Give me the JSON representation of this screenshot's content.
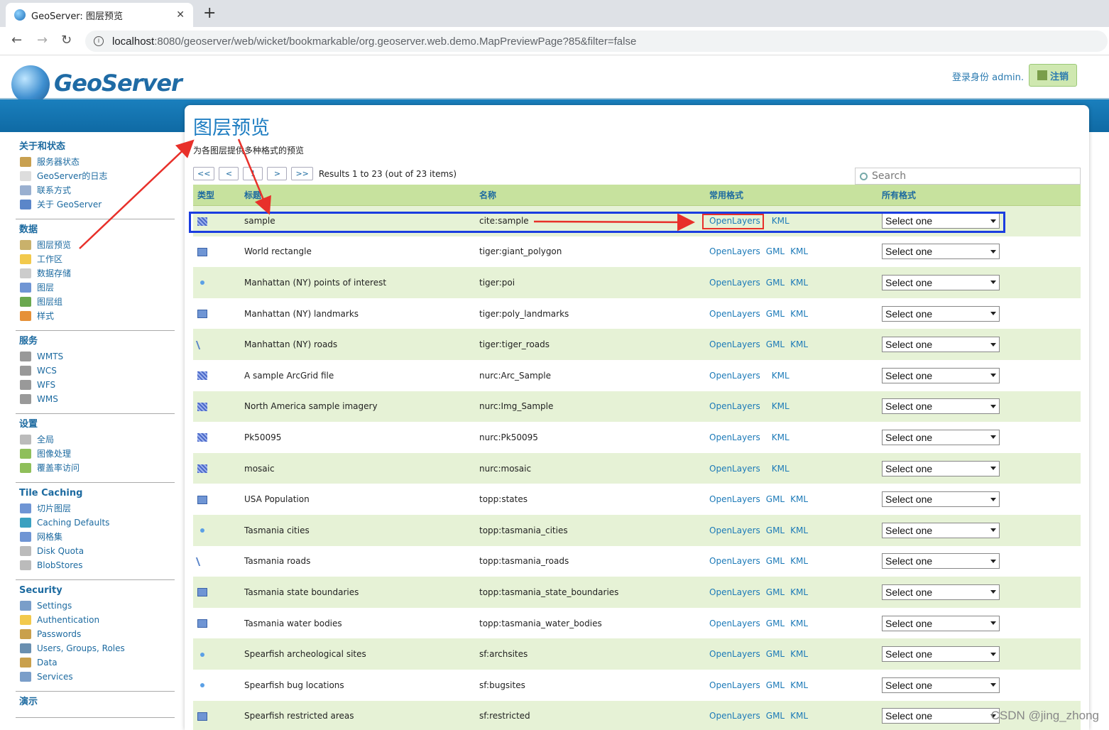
{
  "browser": {
    "tab_title": "GeoServer: 图层预览",
    "tab_close": "✕",
    "new_tab": "+",
    "url_host": "localhost",
    "url_path": ":8080/geoserver/web/wicket/bookmarkable/org.geoserver.web.demo.MapPreviewPage?85&filter=false",
    "back": "←",
    "forward": "→",
    "reload": "↻"
  },
  "header": {
    "logo_text": "GeoServer",
    "login_text": "登录身份 admin.",
    "logout_label": "注销"
  },
  "sidebar": [
    {
      "title": "关于和状态",
      "items": [
        {
          "label": "服务器状态",
          "icon": "server-status-icon",
          "color": "#c8a050"
        },
        {
          "label": "GeoServer的日志",
          "icon": "log-icon",
          "color": "#dddddd"
        },
        {
          "label": "联系方式",
          "icon": "contact-icon",
          "color": "#9ab0d0"
        },
        {
          "label": "关于 GeoServer",
          "icon": "about-icon",
          "color": "#5b86c9"
        }
      ]
    },
    {
      "title": "数据",
      "items": [
        {
          "label": "图层预览",
          "icon": "layer-preview-icon",
          "color": "#c9b16b"
        },
        {
          "label": "工作区",
          "icon": "workspace-icon",
          "color": "#f2c94c"
        },
        {
          "label": "数据存储",
          "icon": "datastore-icon",
          "color": "#cccccc"
        },
        {
          "label": "图层",
          "icon": "layers-icon",
          "color": "#6f95d4"
        },
        {
          "label": "图层组",
          "icon": "layer-group-icon",
          "color": "#6aa84f"
        },
        {
          "label": "样式",
          "icon": "styles-icon",
          "color": "#e69138"
        }
      ]
    },
    {
      "title": "服务",
      "items": [
        {
          "label": "WMTS",
          "icon": "wmts-icon",
          "color": "#999999"
        },
        {
          "label": "WCS",
          "icon": "wcs-icon",
          "color": "#999999"
        },
        {
          "label": "WFS",
          "icon": "wfs-icon",
          "color": "#999999"
        },
        {
          "label": "WMS",
          "icon": "wms-icon",
          "color": "#999999"
        }
      ]
    },
    {
      "title": "设置",
      "items": [
        {
          "label": "全局",
          "icon": "global-icon",
          "color": "#bbbbbb"
        },
        {
          "label": "图像处理",
          "icon": "image-processing-icon",
          "color": "#8fbf5a"
        },
        {
          "label": "覆盖率访问",
          "icon": "coverage-access-icon",
          "color": "#8fbf5a"
        }
      ]
    },
    {
      "title": "Tile Caching",
      "items": [
        {
          "label": "切片图层",
          "icon": "tile-layers-icon",
          "color": "#6f95d4"
        },
        {
          "label": "Caching Defaults",
          "icon": "caching-defaults-icon",
          "color": "#3aa0c0"
        },
        {
          "label": "网格集",
          "icon": "gridsets-icon",
          "color": "#6f95d4"
        },
        {
          "label": "Disk Quota",
          "icon": "disk-quota-icon",
          "color": "#bbbbbb"
        },
        {
          "label": "BlobStores",
          "icon": "blobstores-icon",
          "color": "#bbbbbb"
        }
      ]
    },
    {
      "title": "Security",
      "items": [
        {
          "label": "Settings",
          "icon": "security-settings-icon",
          "color": "#7a9ec9"
        },
        {
          "label": "Authentication",
          "icon": "authentication-icon",
          "color": "#f2c94c"
        },
        {
          "label": "Passwords",
          "icon": "passwords-icon",
          "color": "#c9a04c"
        },
        {
          "label": "Users, Groups, Roles",
          "icon": "users-icon",
          "color": "#6a8fb0"
        },
        {
          "label": "Data",
          "icon": "data-security-icon",
          "color": "#c9a04c"
        },
        {
          "label": "Services",
          "icon": "services-security-icon",
          "color": "#7a9ec9"
        }
      ]
    },
    {
      "title": "演示",
      "items": []
    }
  ],
  "main": {
    "title": "图层预览",
    "description": "为各图层提供多种格式的预览",
    "pager": [
      "<<",
      "<",
      "1",
      ">",
      ">>"
    ],
    "results": "Results 1 to 23 (out of 23 items)",
    "search_placeholder": "Search",
    "columns": [
      "类型",
      "标题",
      "名称",
      "常用格式",
      "所有格式"
    ],
    "select_label": "Select one",
    "formats": {
      "openlayers": "OpenLayers",
      "gml": "GML",
      "kml": "KML"
    },
    "rows": [
      {
        "type": "raster",
        "title": "sample",
        "name": "cite:sample",
        "gml": false
      },
      {
        "type": "poly",
        "title": "World rectangle",
        "name": "tiger:giant_polygon",
        "gml": true
      },
      {
        "type": "point",
        "title": "Manhattan (NY) points of interest",
        "name": "tiger:poi",
        "gml": true
      },
      {
        "type": "poly",
        "title": "Manhattan (NY) landmarks",
        "name": "tiger:poly_landmarks",
        "gml": true
      },
      {
        "type": "line",
        "title": "Manhattan (NY) roads",
        "name": "tiger:tiger_roads",
        "gml": true
      },
      {
        "type": "raster",
        "title": "A sample ArcGrid file",
        "name": "nurc:Arc_Sample",
        "gml": false
      },
      {
        "type": "raster",
        "title": "North America sample imagery",
        "name": "nurc:Img_Sample",
        "gml": false
      },
      {
        "type": "raster",
        "title": "Pk50095",
        "name": "nurc:Pk50095",
        "gml": false
      },
      {
        "type": "raster",
        "title": "mosaic",
        "name": "nurc:mosaic",
        "gml": false
      },
      {
        "type": "poly",
        "title": "USA Population",
        "name": "topp:states",
        "gml": true
      },
      {
        "type": "point",
        "title": "Tasmania cities",
        "name": "topp:tasmania_cities",
        "gml": true
      },
      {
        "type": "line",
        "title": "Tasmania roads",
        "name": "topp:tasmania_roads",
        "gml": true
      },
      {
        "type": "poly",
        "title": "Tasmania state boundaries",
        "name": "topp:tasmania_state_boundaries",
        "gml": true
      },
      {
        "type": "poly",
        "title": "Tasmania water bodies",
        "name": "topp:tasmania_water_bodies",
        "gml": true
      },
      {
        "type": "point",
        "title": "Spearfish archeological sites",
        "name": "sf:archsites",
        "gml": true
      },
      {
        "type": "point",
        "title": "Spearfish bug locations",
        "name": "sf:bugsites",
        "gml": true
      },
      {
        "type": "poly",
        "title": "Spearfish restricted areas",
        "name": "sf:restricted",
        "gml": true
      }
    ]
  },
  "watermark": "CSDN @jing_zhong",
  "colors": {
    "accent": "#1f7ec2",
    "row_green": "#e6f2d6",
    "header_green": "#c7e29e",
    "annotation_red": "#e8302a",
    "annotation_blue": "#1a3de0"
  }
}
